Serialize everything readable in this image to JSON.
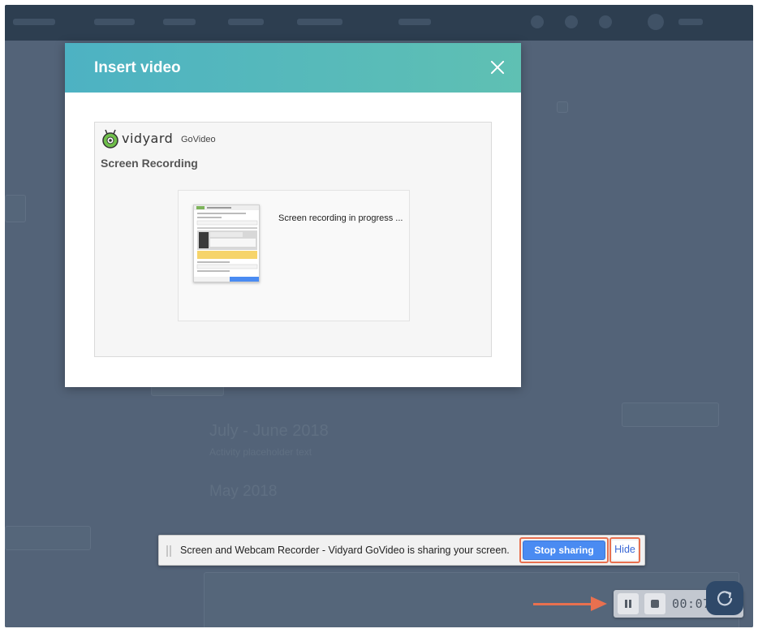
{
  "modal": {
    "title": "Insert video",
    "close_icon": "close-icon",
    "brand": {
      "name": "vidyard",
      "product": "GoVideo"
    },
    "heading": "Screen Recording",
    "status_text": "Screen recording in progress ..."
  },
  "share_bar": {
    "message": "Screen and Webcam Recorder - Vidyard GoVideo is sharing your screen.",
    "stop_label": "Stop sharing",
    "hide_label": "Hide"
  },
  "recorder": {
    "timer": "00:07",
    "pause_icon": "pause-icon",
    "stop_icon": "stop-icon",
    "refresh_icon": "refresh-icon"
  },
  "colors": {
    "header_gradient_start": "#4db2c3",
    "header_gradient_end": "#5fc0b3",
    "stop_button": "#4a8bf2",
    "highlight": "#e8704f",
    "nav_bar": "#2d3e50"
  }
}
